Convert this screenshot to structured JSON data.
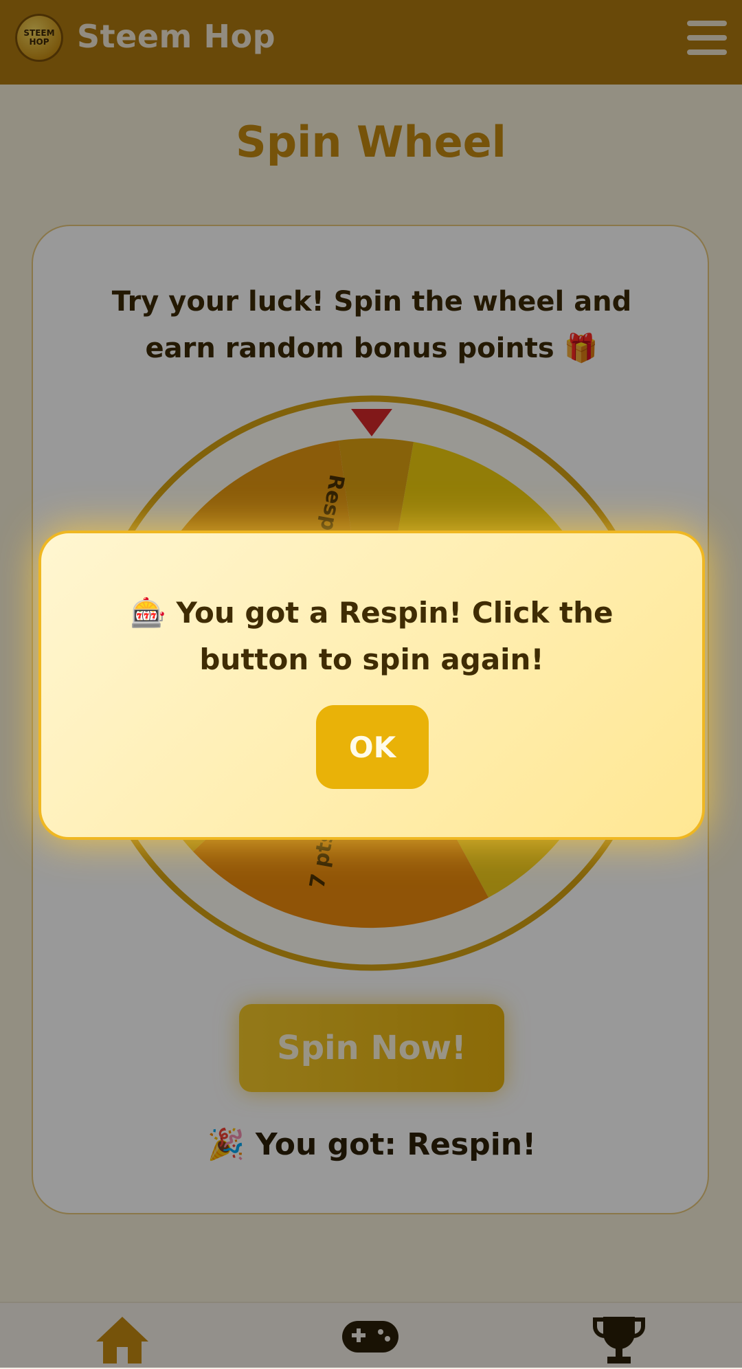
{
  "header": {
    "app_title": "Steem Hop",
    "logo_text_1": "STEEM",
    "logo_text_2": "HOP",
    "brand_color": "#b07a0f"
  },
  "page": {
    "title": "Spin Wheel"
  },
  "card": {
    "description": "Try your luck! Spin the wheel and earn random bonus points 🎁",
    "wheel_labels": [
      "Respin",
      "7 pts"
    ],
    "spin_button": "Spin Now!",
    "result_text": "🎉 You got: Respin!"
  },
  "modal": {
    "message": "🎰 You got a Respin! Click the button to spin again!",
    "ok_label": "OK"
  },
  "bottom_nav": {
    "items": [
      {
        "icon": "home-icon"
      },
      {
        "icon": "gamepad-icon"
      },
      {
        "icon": "trophy-icon"
      }
    ]
  },
  "colors": {
    "accent": "#e9b208",
    "pointer": "#d8282a"
  }
}
